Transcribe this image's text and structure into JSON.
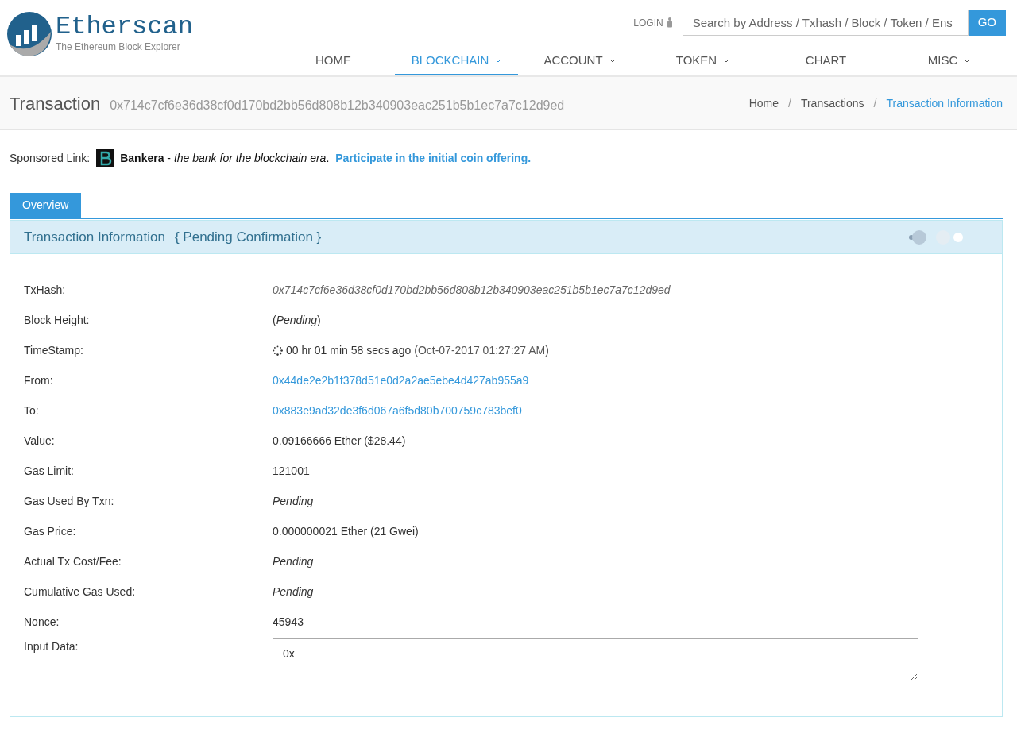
{
  "logo": {
    "name": "Etherscan",
    "tagline": "The Ethereum Block Explorer"
  },
  "login": "LOGIN",
  "search": {
    "placeholder": "Search by Address / Txhash / Block / Token / Ens",
    "button": "GO"
  },
  "nav": [
    {
      "label": "HOME",
      "selected": false,
      "dropdown": false
    },
    {
      "label": "BLOCKCHAIN",
      "selected": true,
      "dropdown": true
    },
    {
      "label": "ACCOUNT",
      "selected": false,
      "dropdown": true
    },
    {
      "label": "TOKEN",
      "selected": false,
      "dropdown": true
    },
    {
      "label": "CHART",
      "selected": false,
      "dropdown": false
    },
    {
      "label": "MISC",
      "selected": false,
      "dropdown": true
    }
  ],
  "page_title": {
    "title": "Transaction",
    "hash": "0x714c7cf6e36d38cf0d170bd2bb56d808b12b340903eac251b5b1ec7a7c12d9ed"
  },
  "breadcrumb_separator": "/",
  "breadcrumb": [
    {
      "label": "Home",
      "selected": false
    },
    {
      "label": "Transactions",
      "selected": false
    },
    {
      "label": "Transaction Information",
      "selected": true
    }
  ],
  "sponsored": {
    "label": "Sponsored Link:",
    "text": "**Bankera** - *the bank for the blockchain era*.",
    "link": "Participate in the initial coin offering."
  },
  "tabs": [
    {
      "label": "Overview",
      "selected": true
    }
  ],
  "panel": {
    "title": "Transaction Information",
    "subtitle": "{ Pending Confirmation }"
  },
  "rows": [
    {
      "label": "TxHash:",
      "kind": "hash",
      "value": "0x714c7cf6e36d38cf0d170bd2bb56d808b12b340903eac251b5b1ec7a7c12d9ed"
    },
    {
      "label": "Block Height:",
      "kind": "rich",
      "value": "(*Pending*)"
    },
    {
      "label": "TimeStamp:",
      "kind": "timestamp",
      "value": "00 hr 01 min 58 secs ago",
      "note": "(Oct-07-2017 01:27:27 AM)"
    },
    {
      "label": "From:",
      "kind": "link",
      "value": "0x44de2e2b1f378d51e0d2a2ae5ebe4d427ab955a9"
    },
    {
      "label": "To:",
      "kind": "link",
      "value": "0x883e9ad32de3f6d067a6f5d80b700759c783bef0"
    },
    {
      "label": "Value:",
      "kind": "text",
      "value": "0.09166666 Ether ($28.44)"
    },
    {
      "label": "Gas Limit:",
      "kind": "text",
      "value": "121001"
    },
    {
      "label": "Gas Used By Txn:",
      "kind": "italic",
      "value": "Pending"
    },
    {
      "label": "Gas Price:",
      "kind": "text",
      "value": "0.000000021 Ether (21 Gwei)"
    },
    {
      "label": "Actual Tx Cost/Fee:",
      "kind": "italic",
      "value": "Pending"
    },
    {
      "label": "Cumulative Gas Used:",
      "kind": "italic",
      "value": "Pending"
    },
    {
      "label": "Nonce:",
      "kind": "text",
      "value": "45943"
    },
    {
      "label": "Input Data:",
      "kind": "textarea",
      "value": "0x"
    }
  ]
}
